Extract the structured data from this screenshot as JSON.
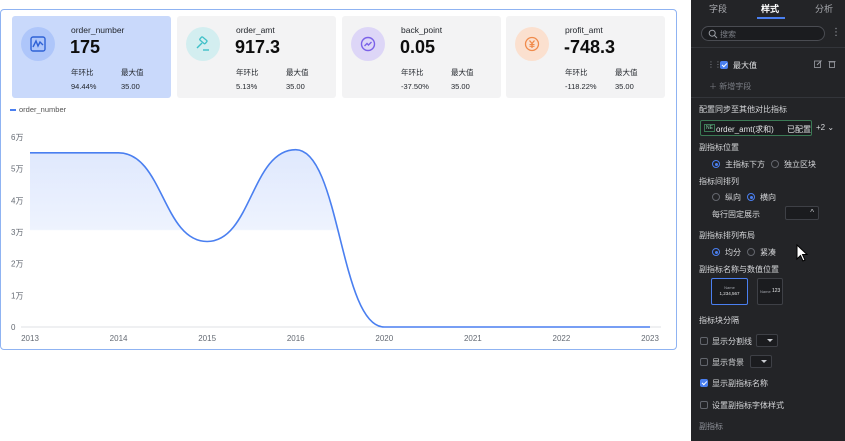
{
  "cards": [
    {
      "name": "order_number",
      "value": "175",
      "label1": "年环比",
      "label2": "最大值",
      "val1": "94.44%",
      "val2": "35.00",
      "icon": "chart-icon",
      "color": "#4a7ff0"
    },
    {
      "name": "order_amt",
      "value": "917.3",
      "label1": "年环比",
      "label2": "最大值",
      "val1": "5.13%",
      "val2": "35.00",
      "icon": "hammer-icon",
      "color": "#3fc0c8"
    },
    {
      "name": "back_point",
      "value": "0.05",
      "label1": "年环比",
      "label2": "最大值",
      "val1": "-37.50%",
      "val2": "35.00",
      "icon": "trend-icon",
      "color": "#7b61e8"
    },
    {
      "name": "profit_amt",
      "value": "-748.3",
      "label1": "年环比",
      "label2": "最大值",
      "val1": "-118.22%",
      "val2": "35.00",
      "icon": "yen-icon",
      "color": "#f08a4b"
    }
  ],
  "chart_data": {
    "type": "area",
    "x": [
      "2013",
      "2014",
      "2015",
      "2016",
      "2020",
      "2021",
      "2022",
      "2023"
    ],
    "series": [
      {
        "name": "order_number",
        "values": [
          55000,
          55000,
          27000,
          56000,
          0,
          0,
          0,
          0
        ]
      }
    ],
    "ylim": [
      0,
      60000
    ],
    "yticks": [
      "0",
      "1万",
      "2万",
      "3万",
      "4万",
      "5万",
      "6万"
    ],
    "legend": "order_number",
    "line_color": "#4a7ff0"
  },
  "panel": {
    "tabs": [
      "字段",
      "样式",
      "分析"
    ],
    "active_tab": "样式",
    "search_placeholder": "搜索",
    "more": "⋮",
    "field_label": "最大值",
    "add_field": "新增字段",
    "sync_title": "配置同步至其他对比指标",
    "cmp_tag": "NE",
    "cmp_text": "order_amt(求和)",
    "cmp_status": "已配置",
    "cmp_more": "+2",
    "pos_title": "副指标位置",
    "pos_opt1": "主指标下方",
    "pos_opt2": "独立区块",
    "arr_title": "指标间排列",
    "arr_opt1": "纵向",
    "arr_opt2": "横向",
    "fixed_title": "每行固定展示",
    "layout_title": "副指标排列布局",
    "layout_opt1": "均分",
    "layout_opt2": "紧凑",
    "namepos_title": "副指标名称与数值位置",
    "thumb1_name": "Name",
    "thumb1_val": "1,234,567",
    "thumb2_name": "Name",
    "thumb2_val": "123",
    "sep_title": "指标块分隔",
    "opt_divider": "显示分割线",
    "opt_bg": "显示背景",
    "opt_subname": "显示副指标名称",
    "opt_font": "设置副指标字体样式",
    "sub_title": "副指标"
  }
}
